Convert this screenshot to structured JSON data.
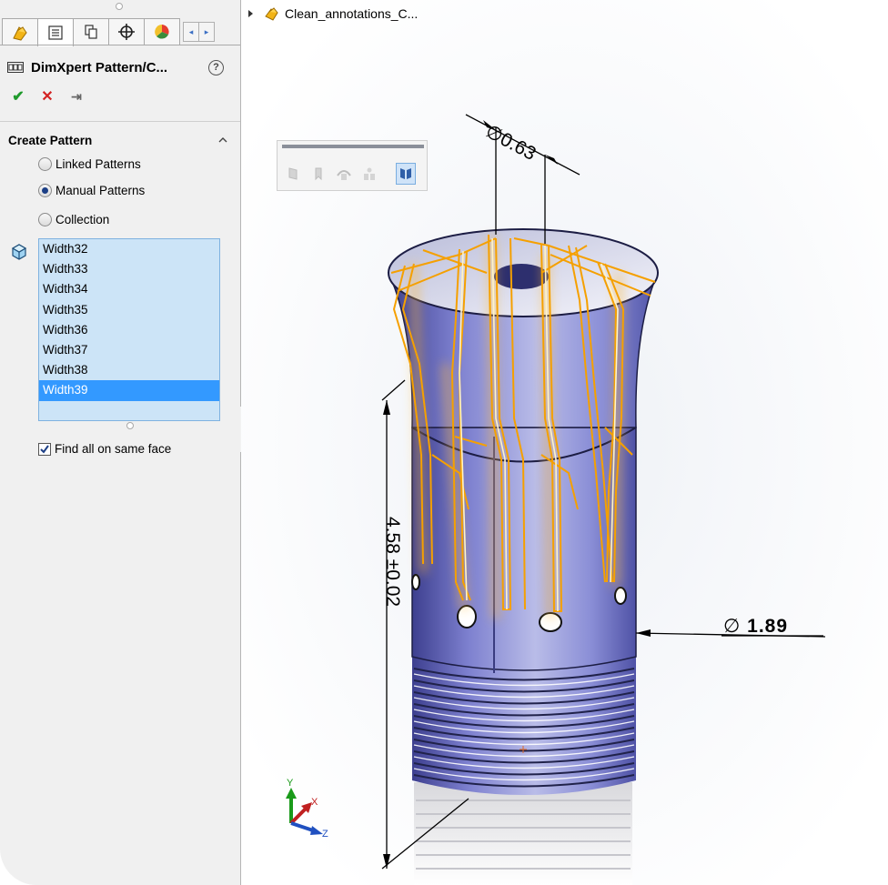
{
  "panel": {
    "tabs": [
      "feature-manager-icon",
      "property-manager-icon",
      "configuration-manager-icon",
      "dimxpert-manager-icon",
      "display-manager-icon"
    ],
    "scroll_left": "◂",
    "scroll_right": "▸",
    "title": "DimXpert Pattern/C...",
    "help": "?",
    "actions": {
      "ok": "✔",
      "cancel": "✕",
      "pin": "⇥"
    },
    "group": {
      "title": "Create Pattern",
      "options": [
        {
          "label": "Linked Patterns",
          "checked": false
        },
        {
          "label": "Manual Patterns",
          "checked": true
        },
        {
          "label": "Collection",
          "checked": false
        }
      ],
      "list_items": [
        "Width32",
        "Width33",
        "Width34",
        "Width35",
        "Width36",
        "Width37",
        "Width38",
        "Width39"
      ],
      "selected_item": "Width39",
      "find_all": {
        "label": "Find all on same face",
        "checked": true
      }
    }
  },
  "viewport": {
    "tree_label": "Clean_annotations_C...",
    "dimensions": {
      "top_diameter": "0.63",
      "length": "4.58 ±0.02",
      "outer_diameter": "1.89"
    },
    "triad": {
      "y": "Y",
      "x": "X",
      "z": "Z"
    }
  },
  "colors": {
    "selection": "#3399ff",
    "list_bg": "#cce4f7",
    "highlight_orange": "#ffa500",
    "body_blue": "#6b6fc4"
  }
}
